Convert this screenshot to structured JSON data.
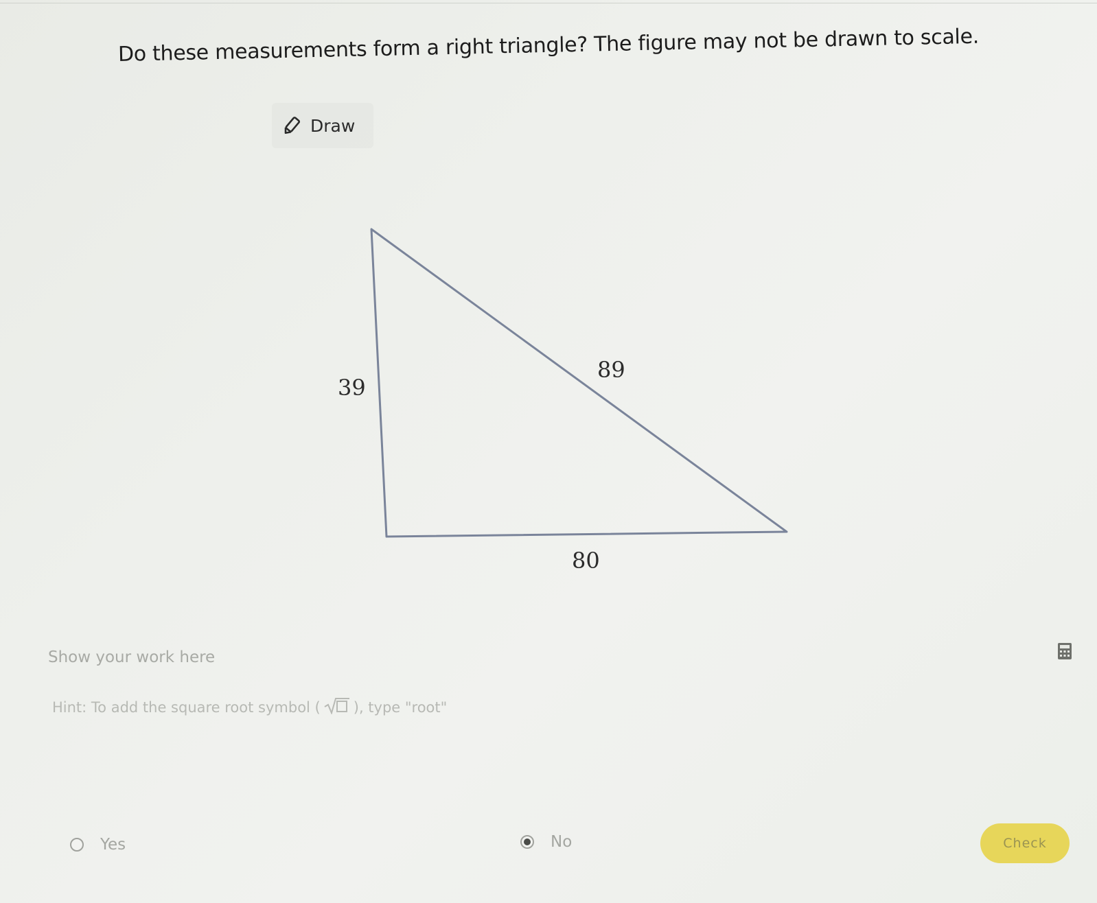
{
  "question": {
    "text": "Do these measurements form a right triangle? The figure may not be drawn to scale."
  },
  "toolbar": {
    "draw_label": "Draw",
    "draw_icon": "pencil-icon"
  },
  "figure": {
    "side_left": "39",
    "side_hypotenuse": "89",
    "side_bottom": "80",
    "stroke_color": "#7a849a"
  },
  "work": {
    "placeholder": "Show your work here",
    "hint_prefix": "Hint: To add the square root symbol (",
    "hint_suffix": "), type \"root\"",
    "calculator_icon": "calculator-icon"
  },
  "answer": {
    "options": [
      {
        "label": "Yes",
        "selected": false
      },
      {
        "label": "No",
        "selected": true
      }
    ],
    "check_label": "Check",
    "check_color": "#e7d65a"
  }
}
